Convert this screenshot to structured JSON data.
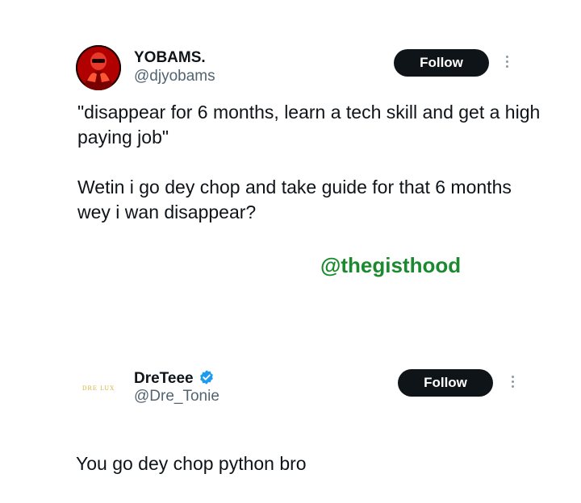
{
  "tweet1": {
    "display_name": "YOBAMS.",
    "handle": "@djyobams",
    "follow_label": "Follow",
    "text": "\"disappear for 6 months, learn a tech skill and get a high paying job\"\n\nWetin i go dey chop and take guide for that 6 months wey i wan disappear?"
  },
  "watermark": "@thegisthood",
  "tweet2": {
    "display_name": "DreTeee",
    "handle": "@Dre_Tonie",
    "follow_label": "Follow",
    "text": "You go dey chop python bro",
    "avatar_text": "DRE LUX"
  },
  "colors": {
    "follow_bg": "#0f1419",
    "verified": "#1d9bf0",
    "watermark": "#1b8a2e",
    "handle": "#536471"
  },
  "icons": [
    "verified-badge-icon",
    "more-options-icon"
  ]
}
